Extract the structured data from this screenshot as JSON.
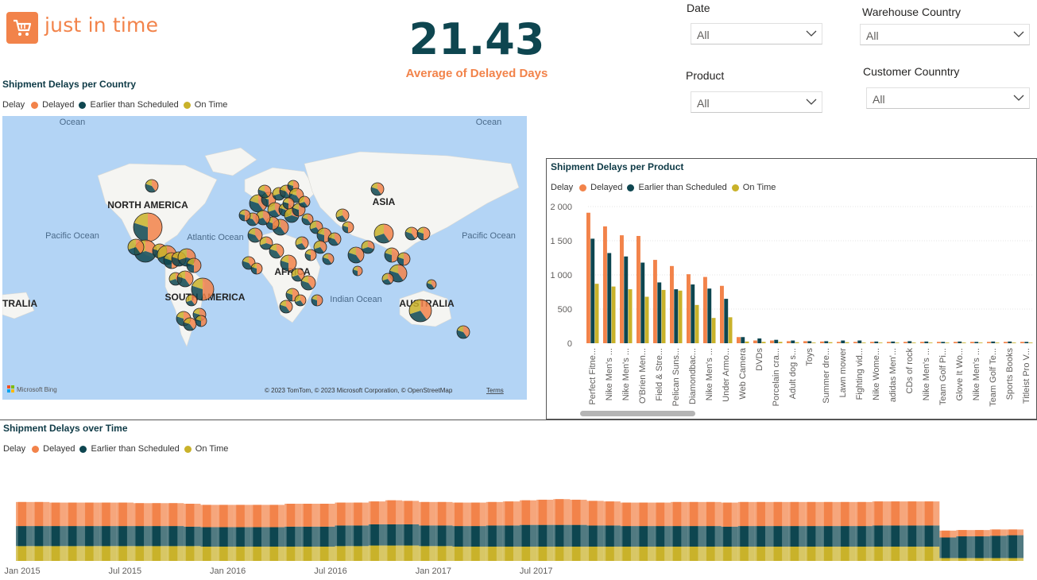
{
  "brand": {
    "name": "just in time",
    "icon": "shopping-cart-icon"
  },
  "kpi": {
    "value": "21.43",
    "label": "Average of Delayed Days"
  },
  "filters": {
    "date": {
      "label": "Date",
      "value": "All"
    },
    "warehouse_country": {
      "label": "Warehouse Country",
      "value": "All"
    },
    "product": {
      "label": "Product",
      "value": "All"
    },
    "customer_country": {
      "label": "Customer Counntry",
      "value": "All"
    }
  },
  "legend": {
    "title": "Delay",
    "items": [
      "Delayed",
      "Earlier than Scheduled",
      "On Time"
    ]
  },
  "colors": {
    "delayed": "#f2834a",
    "earlier": "#0e4650",
    "on_time": "#c9b22a",
    "accent": "#f2834a",
    "map_water": "#b3d4f5",
    "map_land": "#f5f5f2"
  },
  "map_card": {
    "title": "Shipment Delays per Country",
    "labels": {
      "north_america": "NORTH AMERICA",
      "south_america": "SOUTH AMERICA",
      "asia": "ASIA",
      "africa": "AFRICA",
      "australia": "AUSTRALIA",
      "australia_left": "TRALIA",
      "ocean_tl": "Ocean",
      "ocean_tr": "Ocean",
      "pacific_left": "Pacific Ocean",
      "atlantic": "Atlantic Ocean",
      "indian": "Indian Ocean",
      "pacific_right": "Pacific Ocean"
    },
    "bing": "Microsoft Bing",
    "copyright": "© 2023 TomTom, © 2023 Microsoft Corporation, © OpenStreetMap",
    "terms": "Terms"
  },
  "chart_data": [
    {
      "type": "bar",
      "title": "Shipment Delays per Product",
      "categories": [
        "Perfect Fitne...",
        "Nike Men's ...",
        "Nike Men's ...",
        "O'Brien Men...",
        "Field & Stre...",
        "Pelican Suns...",
        "Diamondbac...",
        "Nike Men's ...",
        "Under Armo...",
        "Web Camera",
        "DVDs",
        "Porcelain cra...",
        "Adult dog s...",
        "Toys",
        "Summer dre...",
        "Lawn mower",
        "Fighting vid...",
        "Nike Wome...",
        "adidas Men'...",
        "CDs of rock",
        "Nike Men's ...",
        "Team Golf Pi...",
        "Glove It Wo...",
        "Nike Men's ...",
        "Team Golf Te...",
        "Sports Books",
        "Titleist Pro V..."
      ],
      "series": [
        {
          "name": "Delayed",
          "values": [
            1910,
            1710,
            1580,
            1570,
            1220,
            1130,
            1010,
            970,
            840,
            90,
            40,
            40,
            30,
            30,
            25,
            20,
            20,
            20,
            20,
            20,
            20,
            20,
            20,
            20,
            20,
            20,
            20
          ]
        },
        {
          "name": "Earlier than Scheduled",
          "values": [
            1530,
            1320,
            1270,
            1180,
            890,
            790,
            860,
            800,
            650,
            90,
            70,
            50,
            40,
            30,
            30,
            40,
            40,
            25,
            25,
            30,
            25,
            20,
            25,
            20,
            25,
            25,
            20
          ]
        },
        {
          "name": "On Time",
          "values": [
            870,
            830,
            790,
            680,
            780,
            770,
            560,
            370,
            380,
            25,
            20,
            20,
            15,
            10,
            15,
            15,
            10,
            10,
            10,
            10,
            10,
            10,
            10,
            10,
            10,
            10,
            10
          ]
        }
      ],
      "yticks": [
        "2 000",
        "1 500",
        "1 000",
        "500",
        "0"
      ],
      "ylim": [
        0,
        2000
      ]
    },
    {
      "type": "area",
      "title": "Shipment Delays over Time",
      "x_ticks": [
        "Jan 2015",
        "Jul 2015",
        "Jan 2016",
        "Jul 2016",
        "Jan 2017",
        "Jul 2017"
      ],
      "periods": 60,
      "series": [
        {
          "name": "Delayed",
          "values": [
            42,
            42,
            41,
            41,
            41,
            41,
            41,
            40,
            40,
            40,
            40,
            39,
            39,
            39,
            39,
            39,
            40,
            40,
            40,
            40,
            40,
            40,
            42,
            41,
            41,
            41,
            41,
            41,
            41,
            42,
            43,
            44,
            45,
            44,
            43,
            42,
            41,
            41,
            41,
            42,
            42,
            42,
            42,
            42,
            42,
            42,
            42,
            42,
            42,
            42,
            42,
            42,
            42,
            42,
            42,
            12,
            11,
            11,
            11,
            10
          ]
        },
        {
          "name": "Earlier than Scheduled",
          "values": [
            35,
            35,
            35,
            35,
            35,
            35,
            35,
            35,
            35,
            35,
            34,
            34,
            34,
            34,
            34,
            34,
            35,
            35,
            35,
            36,
            36,
            37,
            37,
            37,
            36,
            36,
            36,
            36,
            37,
            37,
            38,
            38,
            38,
            38,
            37,
            37,
            36,
            36,
            36,
            36,
            36,
            36,
            35,
            36,
            36,
            36,
            36,
            36,
            36,
            36,
            36,
            37,
            37,
            37,
            37,
            36,
            38,
            38,
            39,
            40
          ]
        },
        {
          "name": "On Time",
          "values": [
            26,
            26,
            26,
            26,
            26,
            26,
            26,
            26,
            26,
            26,
            26,
            25,
            25,
            25,
            25,
            25,
            25,
            25,
            25,
            26,
            26,
            27,
            27,
            27,
            26,
            26,
            25,
            25,
            25,
            25,
            25,
            25,
            25,
            25,
            25,
            25,
            25,
            25,
            25,
            25,
            25,
            25,
            25,
            25,
            25,
            25,
            25,
            25,
            25,
            25,
            25,
            25,
            25,
            25,
            25,
            5,
            5,
            5,
            5,
            5
          ]
        }
      ]
    }
  ]
}
